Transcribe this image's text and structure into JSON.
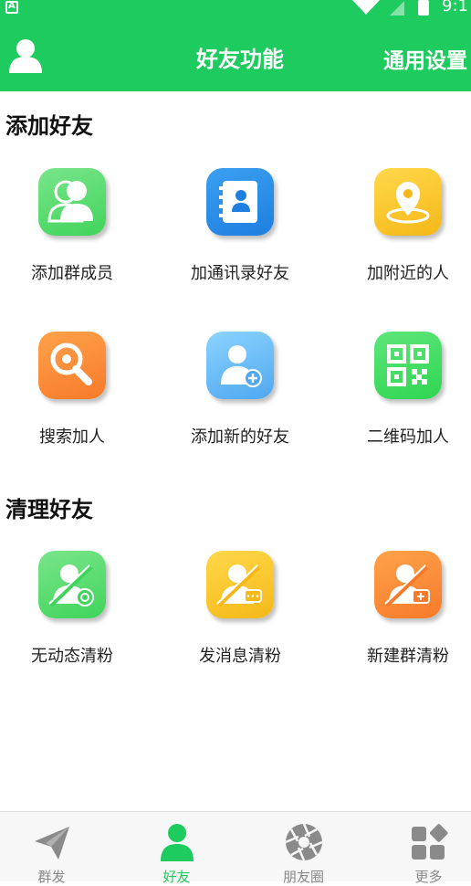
{
  "status_bar": {
    "time": "9:1"
  },
  "header": {
    "title": "好友功能",
    "settings_label": "通用设置"
  },
  "sections": [
    {
      "title": "添加好友",
      "items": [
        {
          "label": "添加群成员",
          "icon": "group-members-icon"
        },
        {
          "label": "加通讯录好友",
          "icon": "contacts-book-icon"
        },
        {
          "label": "加附近的人",
          "icon": "location-pin-icon"
        },
        {
          "label": "搜索加人",
          "icon": "search-icon"
        },
        {
          "label": "添加新的好友",
          "icon": "add-person-icon"
        },
        {
          "label": "二维码加人",
          "icon": "qr-code-icon"
        }
      ]
    },
    {
      "title": "清理好友",
      "items": [
        {
          "label": "无动态清粉",
          "icon": "no-moments-clean-icon"
        },
        {
          "label": "发消息清粉",
          "icon": "message-clean-icon"
        },
        {
          "label": "新建群清粉",
          "icon": "new-group-clean-icon"
        }
      ]
    }
  ],
  "bottom_nav": [
    {
      "label": "群发",
      "icon": "paper-plane-icon",
      "active": false
    },
    {
      "label": "好友",
      "icon": "person-icon",
      "active": true
    },
    {
      "label": "朋友圈",
      "icon": "aperture-icon",
      "active": false
    },
    {
      "label": "更多",
      "icon": "grid-more-icon",
      "active": false
    }
  ],
  "colors": {
    "primary": "#1ecb5e",
    "nav_inactive": "#888888"
  }
}
